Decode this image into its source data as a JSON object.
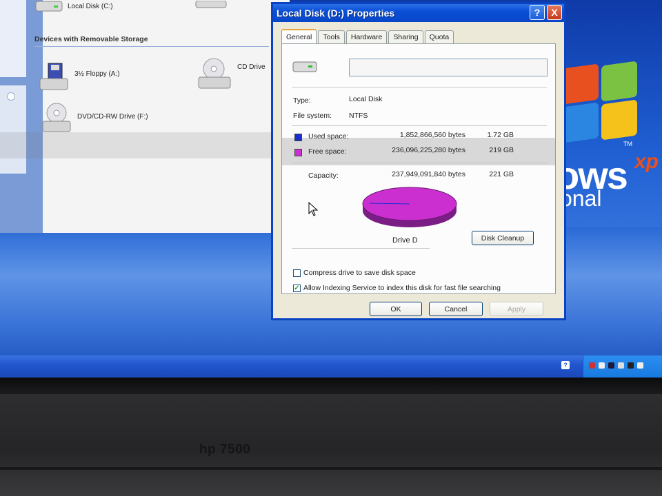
{
  "explorer": {
    "top_item": "Local Disk (C:)",
    "section_title": "Devices with Removable Storage",
    "devices": [
      {
        "label": "3½ Floppy (A:)"
      },
      {
        "label": "CD Drive"
      },
      {
        "label": "DVD/CD-RW Drive (F:)"
      }
    ]
  },
  "wallpaper": {
    "word": "ows",
    "sup": "xp",
    "tm": "TM",
    "edition": "onal"
  },
  "dialog": {
    "title": "Local Disk (D:) Properties",
    "help_button": "?",
    "close_button": "X",
    "tabs": [
      "General",
      "Tools",
      "Hardware",
      "Sharing",
      "Quota"
    ],
    "active_tab": "General",
    "volume_label_value": "",
    "type_label": "Type:",
    "type_value": "Local Disk",
    "fs_label": "File system:",
    "fs_value": "NTFS",
    "used": {
      "label": "Used space:",
      "bytes": "1,852,866,560 bytes",
      "gb": "1.72 GB",
      "color": "#1b2fd0"
    },
    "free": {
      "label": "Free space:",
      "bytes": "236,096,225,280 bytes",
      "gb": "219 GB",
      "color": "#cc2fd0"
    },
    "capacity": {
      "label": "Capacity:",
      "bytes": "237,949,091,840 bytes",
      "gb": "221 GB"
    },
    "drive_label": "Drive D",
    "cleanup_button": "Disk Cleanup",
    "compress_label": "Compress drive to save disk space",
    "compress_checked": false,
    "index_label": "Allow Indexing Service to index this disk for fast file searching",
    "index_checked": true,
    "ok": "OK",
    "cancel": "Cancel",
    "apply": "Apply"
  },
  "taskbar": {
    "help_icon": "?"
  },
  "monitor": {
    "brand": "hp 7500"
  }
}
